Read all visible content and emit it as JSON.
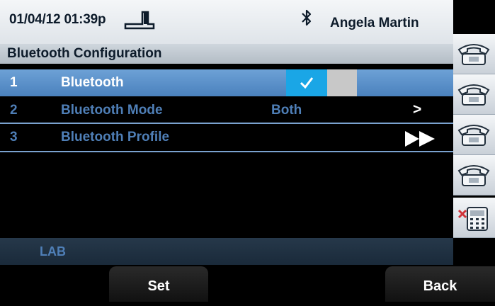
{
  "status_bar": {
    "datetime": "01/04/12 01:39p",
    "username": "Angela Martin",
    "icons": [
      "handset-status-icon",
      "bluetooth-icon"
    ]
  },
  "title": "Bluetooth Configuration",
  "menu": [
    {
      "number": "1",
      "label": "Bluetooth",
      "value": "",
      "enabled": true,
      "selected": true
    },
    {
      "number": "2",
      "label": "Bluetooth Mode",
      "value": "Both",
      "action": ">"
    },
    {
      "number": "3",
      "label": "Bluetooth Profile",
      "value": "",
      "action_icon": "double-arrow-icon"
    }
  ],
  "info_bar": {
    "text": "LAB"
  },
  "softkeys": {
    "set": "Set",
    "back": "Back"
  },
  "line_keys": [
    "phone-line-icon",
    "phone-line-icon",
    "phone-line-icon",
    "phone-line-icon",
    "phone-grid-missed-icon"
  ],
  "colors": {
    "selected_row": "#5b92cc",
    "inactive_text": "#4f7fb7",
    "check_on": "#1aa6e6",
    "toggle_off": "#c8c8c8"
  }
}
